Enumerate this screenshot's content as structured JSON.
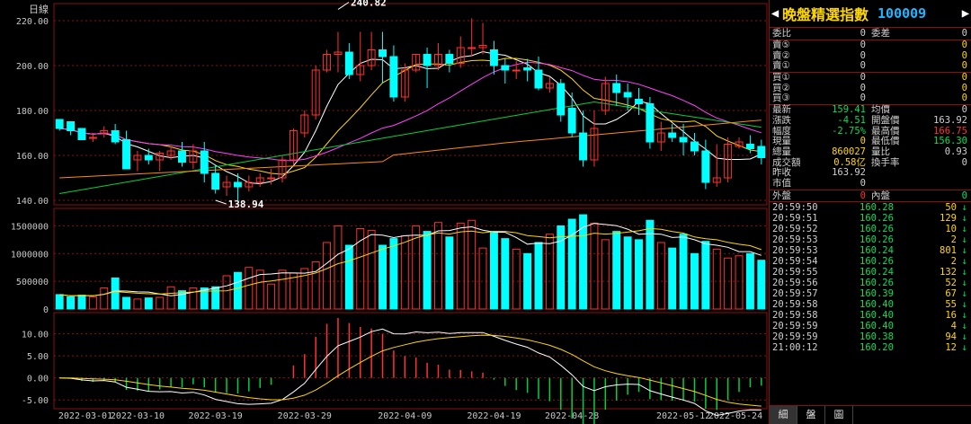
{
  "chart": {
    "period_label": "日線",
    "max_label": "240.82",
    "min_label": "138.94",
    "price_ticks": [
      "220.00",
      "200.00",
      "180.00",
      "160.00",
      "140.00"
    ],
    "volume_ticks": [
      "1500000",
      "1000000",
      "500000",
      "0"
    ],
    "macd_ticks": [
      "10.00",
      "5.00",
      "0.00",
      "-5.00"
    ],
    "date_ticks": [
      "2022-03-01",
      "2022-03-10",
      "2022-03-19",
      "2022-03-29",
      "2022-04-09",
      "2022-04-19",
      "2022-04-28",
      "2022-05-12",
      "2022-05-24"
    ]
  },
  "chart_data": {
    "type": "candlestick",
    "title": "",
    "ylim": [
      138,
      226
    ],
    "candles": [
      [
        176,
        178,
        172,
        171,
        175
      ],
      [
        175,
        177,
        171,
        169,
        173
      ],
      [
        172,
        174,
        167,
        167,
        168
      ],
      [
        168,
        171,
        168,
        166,
        170
      ],
      [
        170,
        172,
        171,
        168,
        173
      ],
      [
        171,
        173,
        166,
        165,
        174
      ],
      [
        167,
        170,
        154,
        158,
        171
      ],
      [
        158,
        160,
        160,
        153,
        162
      ],
      [
        160,
        162,
        158,
        156,
        163
      ],
      [
        158,
        160,
        161,
        153,
        162
      ],
      [
        160,
        163,
        162,
        158,
        164
      ],
      [
        162,
        164,
        157,
        155,
        166
      ],
      [
        157,
        158,
        162,
        154,
        165
      ],
      [
        162,
        165,
        152,
        148,
        166
      ],
      [
        152,
        154,
        145,
        143,
        156
      ],
      [
        146,
        149,
        148,
        142,
        151
      ],
      [
        148,
        150,
        146,
        140,
        152
      ],
      [
        146,
        148,
        148,
        144,
        151
      ],
      [
        148,
        151,
        150,
        146,
        152
      ],
      [
        150,
        153,
        150,
        147,
        154
      ],
      [
        150,
        152,
        158,
        148,
        160
      ],
      [
        158,
        160,
        171,
        156,
        172
      ],
      [
        170,
        172,
        178,
        168,
        180
      ],
      [
        178,
        181,
        198,
        176,
        200
      ],
      [
        198,
        201,
        205,
        197,
        207
      ],
      [
        205,
        205,
        206,
        197,
        215
      ],
      [
        206,
        207,
        196,
        194,
        210
      ],
      [
        196,
        198,
        200,
        193,
        215
      ],
      [
        200,
        202,
        207,
        198,
        215
      ],
      [
        207,
        208,
        204,
        192,
        215
      ],
      [
        204,
        206,
        186,
        184,
        209
      ],
      [
        186,
        188,
        198,
        184,
        201
      ],
      [
        198,
        200,
        205,
        197,
        205
      ],
      [
        205,
        205,
        200,
        190,
        208
      ],
      [
        200,
        202,
        205,
        198,
        210
      ],
      [
        205,
        206,
        201,
        197,
        207
      ],
      [
        201,
        203,
        208,
        199,
        213
      ],
      [
        208,
        209,
        208,
        204,
        221
      ],
      [
        208,
        209,
        209,
        205,
        219
      ],
      [
        207,
        208,
        200,
        196,
        211
      ],
      [
        200,
        202,
        198,
        192,
        203
      ],
      [
        198,
        200,
        198,
        194,
        202
      ],
      [
        199,
        200,
        198,
        193,
        203
      ],
      [
        198,
        200,
        190,
        189,
        204
      ],
      [
        190,
        192,
        192,
        188,
        195
      ],
      [
        192,
        193,
        178,
        175,
        194
      ],
      [
        181,
        183,
        170,
        168,
        188
      ],
      [
        170,
        172,
        158,
        155,
        180
      ],
      [
        158,
        160,
        172,
        155,
        180
      ],
      [
        180,
        182,
        192,
        178,
        195
      ],
      [
        192,
        193,
        188,
        182,
        196
      ],
      [
        188,
        190,
        186,
        180,
        192
      ],
      [
        185,
        187,
        183,
        178,
        190
      ],
      [
        183,
        185,
        166,
        163,
        186
      ],
      [
        166,
        168,
        170,
        162,
        175
      ],
      [
        170,
        172,
        168,
        166,
        174
      ],
      [
        168,
        170,
        166,
        160,
        174
      ],
      [
        166,
        167,
        162,
        160,
        170
      ],
      [
        162,
        165,
        148,
        145,
        167
      ],
      [
        148,
        150,
        150,
        146,
        165
      ],
      [
        150,
        152,
        165,
        148,
        168
      ],
      [
        164,
        166,
        166,
        163,
        168
      ],
      [
        165,
        166,
        163,
        161,
        169
      ],
      [
        164,
        165,
        159,
        156,
        167
      ]
    ],
    "volumes": [
      260000,
      220000,
      250000,
      220000,
      380000,
      560000,
      210000,
      180000,
      200000,
      210000,
      400000,
      330000,
      380000,
      380000,
      400000,
      600000,
      660000,
      750000,
      700000,
      450000,
      700000,
      650000,
      730000,
      850000,
      1200000,
      1500000,
      1150000,
      1450000,
      1420000,
      1150000,
      1270000,
      1320000,
      1500000,
      1400000,
      1560000,
      1300000,
      1550000,
      1600000,
      1100000,
      1400000,
      1270000,
      1080000,
      1000000,
      1200000,
      1350000,
      1500000,
      1620000,
      1700000,
      1550000,
      1250000,
      1400000,
      1300000,
      1250000,
      1600000,
      1200000,
      1100000,
      1350000,
      1000000,
      1220000,
      1080000,
      920000,
      960000,
      1000000,
      880000
    ],
    "volume_colors_note": "red=up, cyan=down",
    "macd_ylim": [
      -7,
      14
    ]
  },
  "quote": {
    "title": "晚盤精選指數",
    "code": "100009",
    "rows_top": [
      {
        "label": "委比",
        "value": "0",
        "label2": "委差",
        "value2": "0"
      }
    ],
    "order_book": [
      {
        "label": "賣⑤",
        "price": "0",
        "vol": "0"
      },
      {
        "label": "賣②",
        "price": "0",
        "vol": "0"
      },
      {
        "label": "賣①",
        "price": "0",
        "vol": "0"
      },
      {
        "label": "買①",
        "price": "0",
        "vol": "0"
      },
      {
        "label": "買②",
        "price": "0",
        "vol": "0"
      },
      {
        "label": "買③",
        "price": "0",
        "vol": "0"
      }
    ],
    "stats": [
      {
        "l1": "最新",
        "v1": "159.41",
        "c1": "#00e060",
        "l2": "均價",
        "v2": "0",
        "c2": "#d0d0d0"
      },
      {
        "l1": "漲跌",
        "v1": "-4.51",
        "c1": "#00e060",
        "l2": "開盤價",
        "v2": "163.92",
        "c2": "#d0d0d0"
      },
      {
        "l1": "幅度",
        "v1": "-2.75%",
        "c1": "#00e060",
        "l2": "最高價",
        "v2": "166.75",
        "c2": "#ff3030"
      },
      {
        "l1": "現量",
        "v1": "0",
        "c1": "#ffd700",
        "l2": "最低價",
        "v2": "156.30",
        "c2": "#00e060"
      },
      {
        "l1": "總量",
        "v1": "860027",
        "c1": "#ffd700",
        "l2": "量比",
        "v2": "0.93",
        "c2": "#d0d0d0"
      },
      {
        "l1": "成交額",
        "v1": "0.58亿",
        "c1": "#ffd700",
        "l2": "換手率",
        "v2": "0",
        "c2": "#d0d0d0"
      },
      {
        "l1": "昨收",
        "v1": "163.92",
        "c1": "#d0d0d0",
        "l2": "",
        "v2": "",
        "c2": "#d0d0d0"
      },
      {
        "l1": "市值",
        "v1": "0",
        "c1": "#d0d0d0",
        "l2": "",
        "v2": "",
        "c2": "#d0d0d0"
      }
    ],
    "outer_label": "外盤",
    "outer_value": "0",
    "inner_label": "內盤",
    "inner_value": "0",
    "ticks": [
      {
        "time": "20:59:50",
        "price": "160.28",
        "vol": "50",
        "dir": "↓"
      },
      {
        "time": "20:59:51",
        "price": "160.26",
        "vol": "129",
        "dir": "↓"
      },
      {
        "time": "20:59:52",
        "price": "160.26",
        "vol": "10",
        "dir": "↓"
      },
      {
        "time": "20:59:53",
        "price": "160.26",
        "vol": "2",
        "dir": "↓"
      },
      {
        "time": "20:59:53",
        "price": "160.24",
        "vol": "801",
        "dir": "↓"
      },
      {
        "time": "20:59:54",
        "price": "160.26",
        "vol": "2",
        "dir": "↓"
      },
      {
        "time": "20:59:55",
        "price": "160.24",
        "vol": "132",
        "dir": "↓"
      },
      {
        "time": "20:59:56",
        "price": "160.26",
        "vol": "52",
        "dir": "↓"
      },
      {
        "time": "20:59:57",
        "price": "160.39",
        "vol": "67",
        "dir": "↓"
      },
      {
        "time": "20:59:58",
        "price": "160.40",
        "vol": "55",
        "dir": "↓"
      },
      {
        "time": "20:59:58",
        "price": "160.40",
        "vol": "16",
        "dir": "↓"
      },
      {
        "time": "20:59:59",
        "price": "160.40",
        "vol": "4",
        "dir": "↓"
      },
      {
        "time": "20:59:59",
        "price": "160.38",
        "vol": "94",
        "dir": "↓"
      },
      {
        "time": "21:00:12",
        "price": "160.20",
        "vol": "12",
        "dir": "↓"
      }
    ],
    "tabs": [
      "細",
      "盤",
      "圖"
    ],
    "colors": {
      "up": "#ff3030",
      "down": "#00ffff",
      "neutral": "#d0d0d0",
      "accent": "#ffd700",
      "price_green": "#00e060"
    }
  }
}
